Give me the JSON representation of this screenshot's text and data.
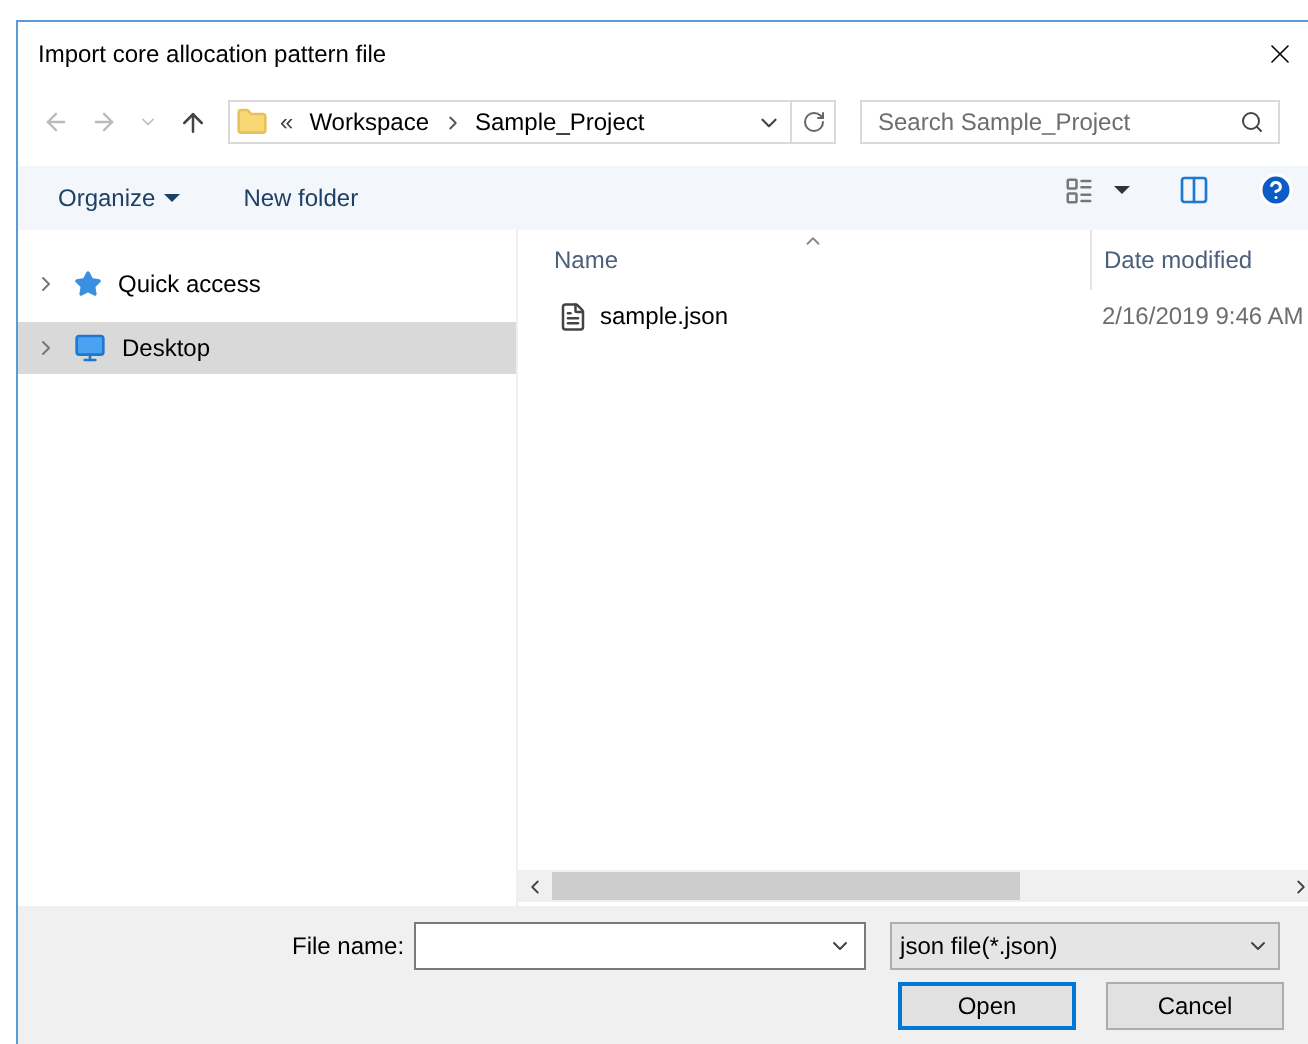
{
  "window": {
    "title": "Import core allocation pattern file"
  },
  "address": {
    "prefix": "«",
    "crumbs": [
      "Workspace",
      "Sample_Project"
    ]
  },
  "search": {
    "placeholder": "Search Sample_Project"
  },
  "toolbar": {
    "organize": "Organize",
    "new_folder": "New folder"
  },
  "sidebar": {
    "items": [
      {
        "label": "Quick access",
        "kind": "star",
        "selected": false
      },
      {
        "label": "Desktop",
        "kind": "desktop",
        "selected": true
      }
    ]
  },
  "table": {
    "columns": [
      "Name",
      "Date modified"
    ],
    "rows": [
      {
        "name": "sample.json",
        "date": "2/16/2019 9:46 AM"
      }
    ]
  },
  "footer": {
    "file_name_label": "File name:",
    "file_type": "json file(*.json)",
    "buttons": [
      "Open",
      "Cancel"
    ]
  }
}
